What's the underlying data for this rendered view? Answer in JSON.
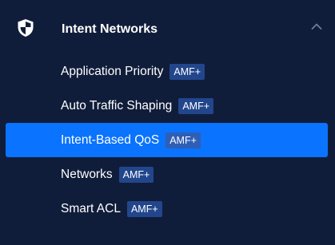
{
  "section": {
    "title": "Intent Networks",
    "icon": "shield-icon",
    "toggle_icon": "chevron-up-icon",
    "expanded": true
  },
  "colors": {
    "background": "#101d3a",
    "active": "#0a73ff",
    "badge": "#22468c"
  },
  "menu": {
    "items": [
      {
        "label": "Application Priority",
        "badge": "AMF+",
        "active": false
      },
      {
        "label": "Auto Traffic Shaping",
        "badge": "AMF+",
        "active": false
      },
      {
        "label": "Intent-Based QoS",
        "badge": "AMF+",
        "active": true
      },
      {
        "label": "Networks",
        "badge": "AMF+",
        "active": false
      },
      {
        "label": "Smart ACL",
        "badge": "AMF+",
        "active": false
      }
    ]
  }
}
